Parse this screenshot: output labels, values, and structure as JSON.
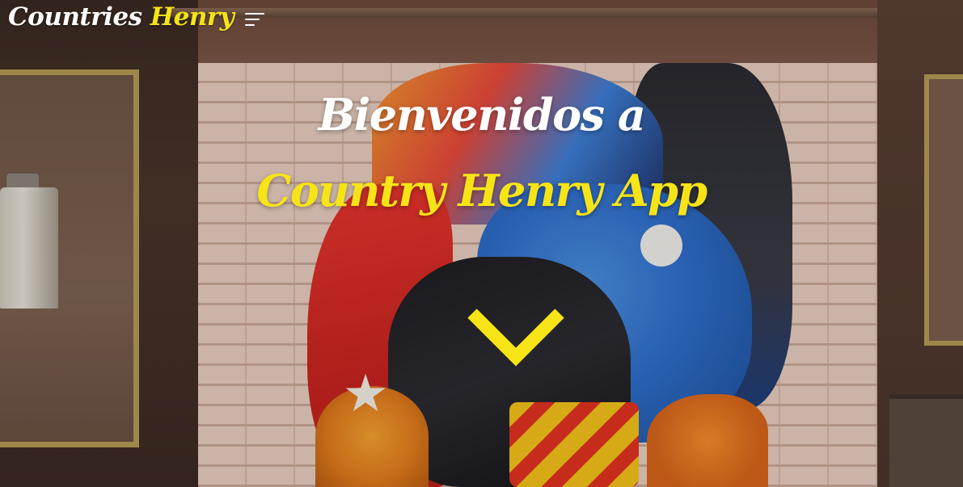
{
  "navbar": {
    "brand_primary": "Countries",
    "brand_accent": "Henry",
    "menu_icon": "hamburger-menu-icon"
  },
  "hero": {
    "line1": "Bienvenidos a",
    "line2": "Country Henry App",
    "scroll_icon": "chevron-down-icon"
  },
  "colors": {
    "accent": "#f7e417",
    "text": "#ffffff"
  }
}
